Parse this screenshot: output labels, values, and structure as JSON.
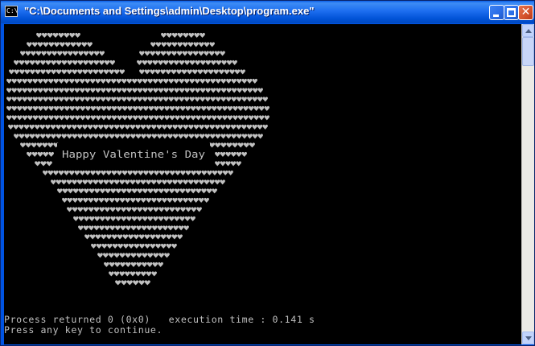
{
  "window": {
    "title": "\"C:\\Documents and Settings\\admin\\Desktop\\program.exe\"",
    "icon": "console-app-icon",
    "icon_text": "C:\\",
    "buttons": {
      "minimize": "minimize-icon",
      "maximize": "maximize-icon",
      "close": "close-icon"
    }
  },
  "console": {
    "background_color": "#000000",
    "text_color": "#c0c0c0",
    "art_glyph": "♥",
    "message": "Happy Valentine's Day",
    "output_lines": [
      "Process returned 0 (0x0)   execution time : 0.141 s",
      "Press any key to continue."
    ]
  },
  "scrollbar": {
    "up": "scroll-up-arrow-icon",
    "down": "scroll-down-arrow-icon"
  }
}
